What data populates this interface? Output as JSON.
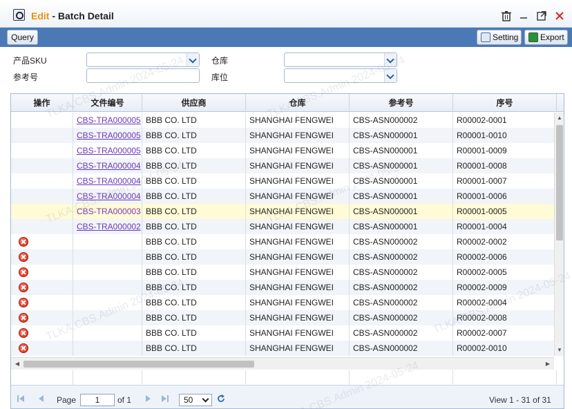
{
  "window": {
    "title_prefix": "Edit",
    "title_sep": " - ",
    "title_main": "Batch Detail",
    "icons": [
      "search-icon",
      "trash-icon",
      "minimize-icon",
      "maximize-icon",
      "close-icon"
    ]
  },
  "toolbar": {
    "query_label": "Query",
    "setting_label": "Setting",
    "export_label": "Export"
  },
  "filters": {
    "sku_label": "产品SKU",
    "warehouse_label": "仓库",
    "ref_label": "参考号",
    "location_label": "库位"
  },
  "grid": {
    "headers": [
      "操作",
      "文件编号",
      "供应商",
      "仓库",
      "参考号",
      "序号"
    ],
    "rows": [
      {
        "has_delete": false,
        "doc": "CBS-TRA000005",
        "supplier": "BBB CO. LTD",
        "warehouse": "SHANGHAI FENGWEI",
        "ref": "CBS-ASN000002",
        "seq": "R00002-0001"
      },
      {
        "has_delete": false,
        "doc": "CBS-TRA000005",
        "supplier": "BBB CO. LTD",
        "warehouse": "SHANGHAI FENGWEI",
        "ref": "CBS-ASN000001",
        "seq": "R00001-0010"
      },
      {
        "has_delete": false,
        "doc": "CBS-TRA000005",
        "supplier": "BBB CO. LTD",
        "warehouse": "SHANGHAI FENGWEI",
        "ref": "CBS-ASN000001",
        "seq": "R00001-0009"
      },
      {
        "has_delete": false,
        "doc": "CBS-TRA000004",
        "supplier": "BBB CO. LTD",
        "warehouse": "SHANGHAI FENGWEI",
        "ref": "CBS-ASN000001",
        "seq": "R00001-0008"
      },
      {
        "has_delete": false,
        "doc": "CBS-TRA000004",
        "supplier": "BBB CO. LTD",
        "warehouse": "SHANGHAI FENGWEI",
        "ref": "CBS-ASN000001",
        "seq": "R00001-0007"
      },
      {
        "has_delete": false,
        "doc": "CBS-TRA000004",
        "supplier": "BBB CO. LTD",
        "warehouse": "SHANGHAI FENGWEI",
        "ref": "CBS-ASN000001",
        "seq": "R00001-0006"
      },
      {
        "has_delete": false,
        "doc": "CBS-TRA000003",
        "supplier": "BBB CO. LTD",
        "warehouse": "SHANGHAI FENGWEI",
        "ref": "CBS-ASN000001",
        "seq": "R00001-0005",
        "selected": true
      },
      {
        "has_delete": false,
        "doc": "CBS-TRA000002",
        "supplier": "BBB CO. LTD",
        "warehouse": "SHANGHAI FENGWEI",
        "ref": "CBS-ASN000001",
        "seq": "R00001-0004"
      },
      {
        "has_delete": true,
        "doc": "",
        "supplier": "BBB CO. LTD",
        "warehouse": "SHANGHAI FENGWEI",
        "ref": "CBS-ASN000002",
        "seq": "R00002-0002"
      },
      {
        "has_delete": true,
        "doc": "",
        "supplier": "BBB CO. LTD",
        "warehouse": "SHANGHAI FENGWEI",
        "ref": "CBS-ASN000002",
        "seq": "R00002-0006"
      },
      {
        "has_delete": true,
        "doc": "",
        "supplier": "BBB CO. LTD",
        "warehouse": "SHANGHAI FENGWEI",
        "ref": "CBS-ASN000002",
        "seq": "R00002-0005"
      },
      {
        "has_delete": true,
        "doc": "",
        "supplier": "BBB CO. LTD",
        "warehouse": "SHANGHAI FENGWEI",
        "ref": "CBS-ASN000002",
        "seq": "R00002-0009"
      },
      {
        "has_delete": true,
        "doc": "",
        "supplier": "BBB CO. LTD",
        "warehouse": "SHANGHAI FENGWEI",
        "ref": "CBS-ASN000002",
        "seq": "R00002-0004"
      },
      {
        "has_delete": true,
        "doc": "",
        "supplier": "BBB CO. LTD",
        "warehouse": "SHANGHAI FENGWEI",
        "ref": "CBS-ASN000002",
        "seq": "R00002-0008"
      },
      {
        "has_delete": true,
        "doc": "",
        "supplier": "BBB CO. LTD",
        "warehouse": "SHANGHAI FENGWEI",
        "ref": "CBS-ASN000002",
        "seq": "R00002-0007"
      },
      {
        "has_delete": true,
        "doc": "",
        "supplier": "BBB CO. LTD",
        "warehouse": "SHANGHAI FENGWEI",
        "ref": "CBS-ASN000002",
        "seq": "R00002-0010"
      }
    ]
  },
  "pager": {
    "page_label": "Page",
    "page_value": "1",
    "of_label": "of 1",
    "page_size": "50",
    "view_text": "View 1 - 31 of 31"
  },
  "watermark_text": "TLKA.CBS.Admin 2024-05-24",
  "colors": {
    "toolbar": "#4a79b6",
    "accent": "#e8920c",
    "link": "#6b39b8",
    "selected_row": "#fffbd6",
    "delete_icon": "#d12a17"
  }
}
